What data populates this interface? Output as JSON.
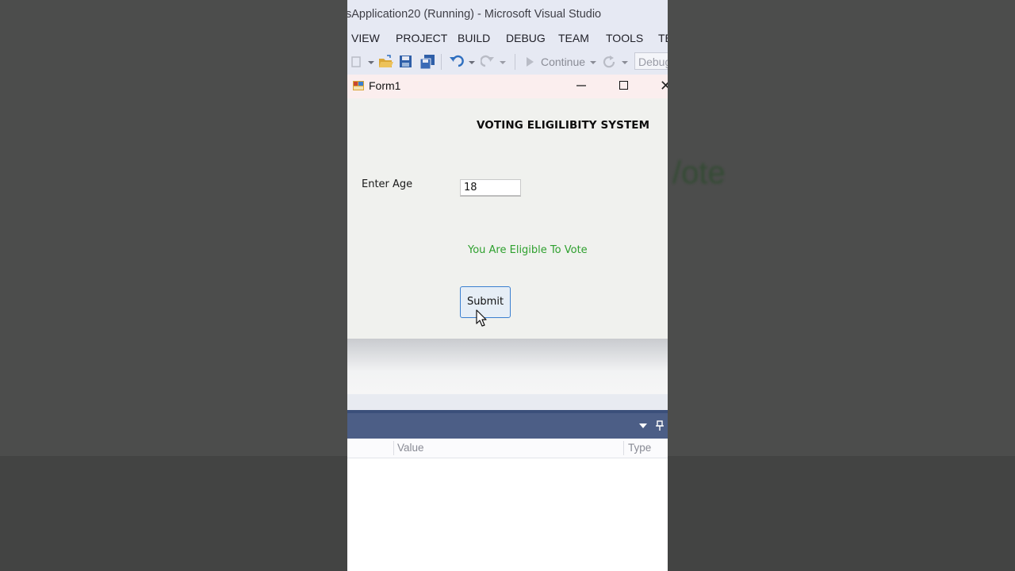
{
  "background": {
    "ghost_text": "/ote"
  },
  "vs": {
    "title": "sApplication20 (Running) - Microsoft Visual Studio",
    "menu": [
      "VIEW",
      "PROJECT",
      "BUILD",
      "DEBUG",
      "TEAM",
      "TOOLS",
      "TE"
    ],
    "toolbar": {
      "continue_label": "Continue",
      "config_value": "Debug"
    }
  },
  "form": {
    "title": "Form1",
    "heading": "VOTING ELIGILIBITY SYSTEM",
    "age_label": "Enter Age",
    "age_value": "18",
    "result_text": "You Are Eligible To Vote",
    "submit_label": "Submit"
  },
  "panel": {
    "columns": [
      "Value",
      "Type"
    ]
  },
  "colors": {
    "result_green": "#2ea02e",
    "button_border": "#3a7fd0",
    "panel_header": "#4c5e86"
  }
}
